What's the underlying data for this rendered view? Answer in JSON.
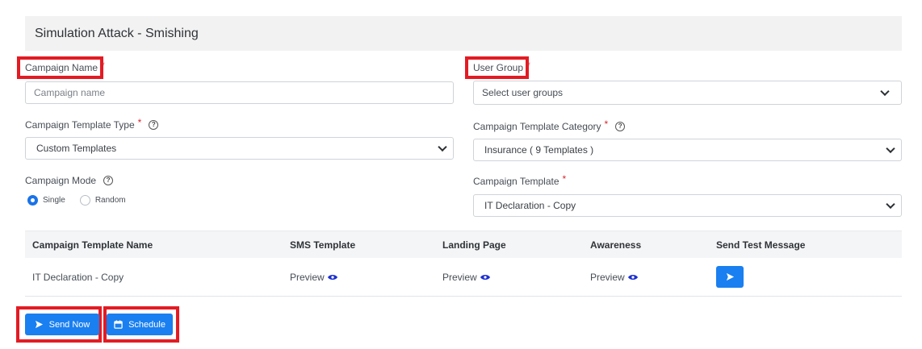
{
  "header": {
    "title": "Simulation Attack - Smishing"
  },
  "fields": {
    "campaign_name": {
      "label": "Campaign Name",
      "required": "*",
      "placeholder": "Campaign name"
    },
    "user_group": {
      "label": "User Group",
      "required": "*",
      "placeholder": "Select user groups"
    },
    "template_type": {
      "label": "Campaign Template Type",
      "required": "*",
      "value": "Custom Templates"
    },
    "template_category": {
      "label": "Campaign Template Category",
      "required": "*",
      "value": "Insurance ( 9 Templates )"
    },
    "campaign_mode": {
      "label": "Campaign Mode",
      "options": [
        "Single",
        "Random"
      ],
      "selected": "Single"
    },
    "campaign_template": {
      "label": "Campaign Template",
      "required": "*",
      "value": "IT Declaration - Copy"
    }
  },
  "table": {
    "headers": [
      "Campaign Template Name",
      "SMS Template",
      "Landing Page",
      "Awareness",
      "Send Test Message"
    ],
    "rows": [
      {
        "name": "IT Declaration - Copy",
        "sms": "Preview",
        "landing": "Preview",
        "awareness": "Preview"
      }
    ]
  },
  "actions": {
    "send_now": "Send Now",
    "schedule": "Schedule"
  },
  "colors": {
    "accent": "#1a7ff0",
    "highlight": "#e31b23",
    "required": "#d9262e"
  },
  "icons": [
    "help-icon",
    "chevron-down-icon",
    "eye-icon",
    "send-icon",
    "calendar-icon"
  ]
}
